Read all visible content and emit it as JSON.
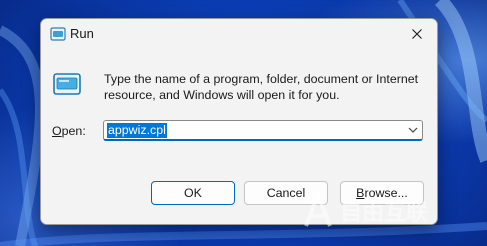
{
  "window": {
    "title": "Run",
    "icon": "run-app-icon",
    "close_icon": "close-icon"
  },
  "prompt": {
    "icon": "run-app-icon",
    "line1": "Type the name of a program, folder, document or Internet",
    "line2": "resource, and Windows will open it for you."
  },
  "open_field": {
    "label_prefix": "",
    "label_mnemonic": "O",
    "label_rest": "pen:",
    "value": "appwiz.cpl",
    "dropdown_icon": "chevron-down-icon"
  },
  "buttons": {
    "ok": "OK",
    "cancel": "Cancel",
    "browse_mnemonic": "B",
    "browse_rest": "rowse..."
  },
  "colors": {
    "accent": "#0067c0",
    "selection": "#0078d7",
    "desktop": "#0b3db5"
  },
  "watermark": {
    "text": "自由互联"
  }
}
